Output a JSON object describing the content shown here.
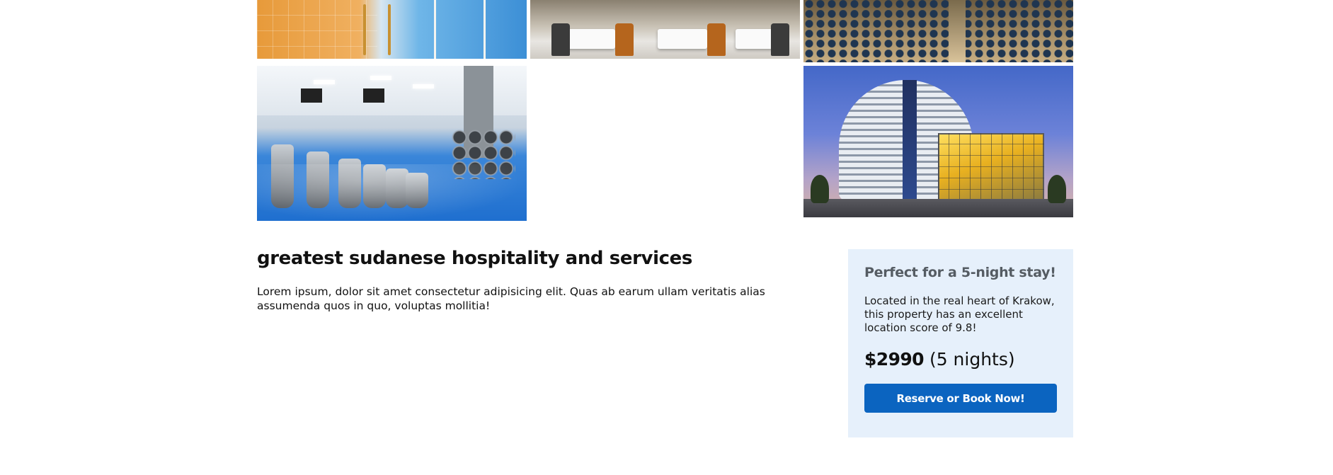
{
  "gallery": {
    "images": [
      {
        "name": "pool",
        "icon": "pool-photo"
      },
      {
        "name": "restaurant",
        "icon": "restaurant-photo"
      },
      {
        "name": "conference-hall",
        "icon": "conference-photo"
      },
      {
        "name": "gym",
        "icon": "gym-photo"
      },
      {
        "name": "hotel-exterior",
        "icon": "hotel-photo"
      }
    ]
  },
  "main": {
    "title": "greatest sudanese hospitality and services",
    "description": "Lorem ipsum, dolor sit amet consectetur adipisicing elit. Quas ab earum ullam veritatis alias assumenda quos in quo, voluptas mollitia!"
  },
  "booking": {
    "title": "Perfect for a 5-night stay!",
    "text": "Located in the real heart of Krakow, this property has an excellent location score of 9.8!",
    "price": "$2990",
    "nights": "(5 nights)",
    "button_label": "Reserve or Book Now!"
  },
  "colors": {
    "accent": "#0b64c0",
    "booking_bg": "#e6f0fb",
    "booking_title": "#555c63"
  }
}
